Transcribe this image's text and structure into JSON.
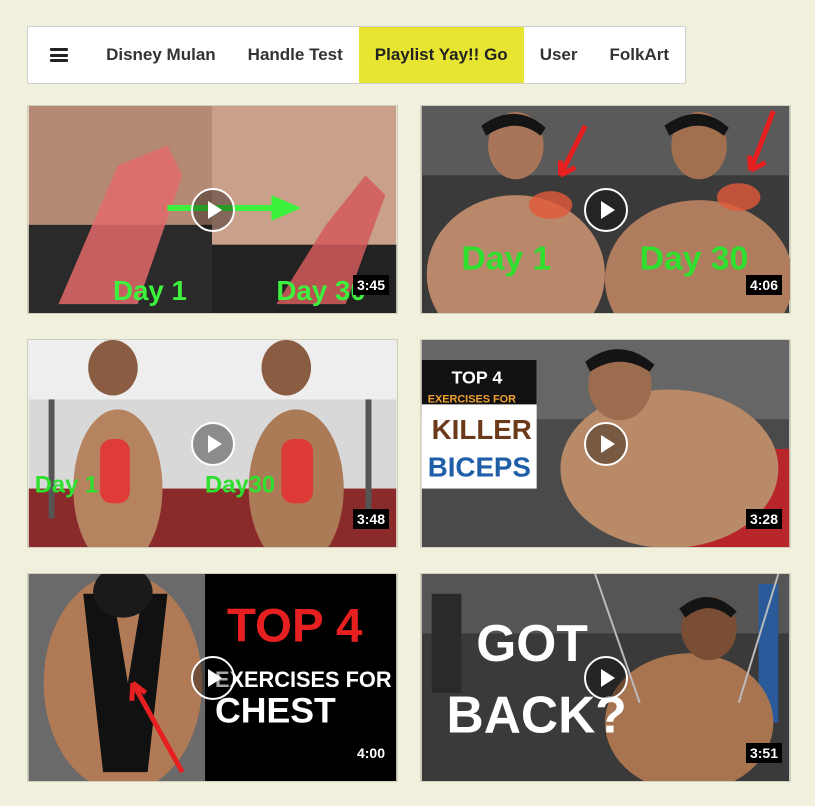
{
  "nav": {
    "menu_icon": "hamburger-menu-icon",
    "items": [
      {
        "label": "Disney Mulan",
        "active": false
      },
      {
        "label": "Handle Test",
        "active": false
      },
      {
        "label": "Playlist Yay!! Go",
        "active": true
      },
      {
        "label": "User",
        "active": false
      },
      {
        "label": "FolkArt",
        "active": false
      }
    ],
    "active_color": "#e8e432"
  },
  "videos": [
    {
      "duration": "3:45",
      "captions": [
        "Day 1",
        "Day 30"
      ]
    },
    {
      "duration": "4:06",
      "captions": [
        "Day 1",
        "Day 30"
      ]
    },
    {
      "duration": "3:48",
      "captions": [
        "Day 1",
        "Day30"
      ]
    },
    {
      "duration": "3:28",
      "captions": [
        "TOP 4",
        "EXERCISES FOR",
        "KILLER",
        "BICEPS"
      ]
    },
    {
      "duration": "4:00",
      "captions": [
        "TOP 4",
        "EXERCISES FOR",
        "CHEST"
      ]
    },
    {
      "duration": "3:51",
      "captions": [
        "GOT",
        "BACK?"
      ]
    }
  ]
}
